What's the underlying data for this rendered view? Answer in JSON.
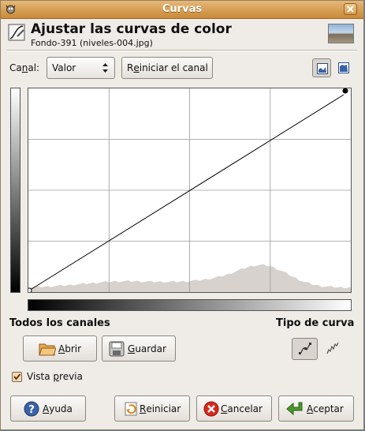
{
  "window": {
    "title": "Curvas"
  },
  "header": {
    "title": "Ajustar las curvas de color",
    "subtitle": "Fondo-391 (niveles-004.jpg)"
  },
  "channel": {
    "label_pre": "Ca",
    "label_ul": "n",
    "label_post": "al:",
    "value": "Valor",
    "reset_pre": "R",
    "reset_ul": "e",
    "reset_post": "iniciar el canal"
  },
  "curve": {
    "points": [
      [
        0,
        0
      ],
      [
        255,
        255
      ]
    ],
    "grid_divisions": 4,
    "histogram_color": "#d7d2cd"
  },
  "section": {
    "all_channels": "Todos los canales",
    "curve_type": "Tipo de curva"
  },
  "buttons": {
    "open": {
      "ul": "A",
      "rest": "brir"
    },
    "save": {
      "ul": "G",
      "rest": "uardar"
    },
    "help": {
      "ul": "A",
      "rest": "yuda"
    },
    "reset": {
      "ul": "R",
      "rest": "einiciar"
    },
    "cancel": {
      "ul": "C",
      "rest": "ancelar"
    },
    "ok": {
      "ul": "A",
      "rest": "ceptar"
    }
  },
  "preview": {
    "pre": "Vista ",
    "ul": "p",
    "post": "revia",
    "checked": true
  },
  "colors": {
    "title_bar": "#d8a35d",
    "accent_cancel": "#d8281c",
    "accent_ok": "#4a9a2a",
    "accent_help": "#3a62a7"
  }
}
